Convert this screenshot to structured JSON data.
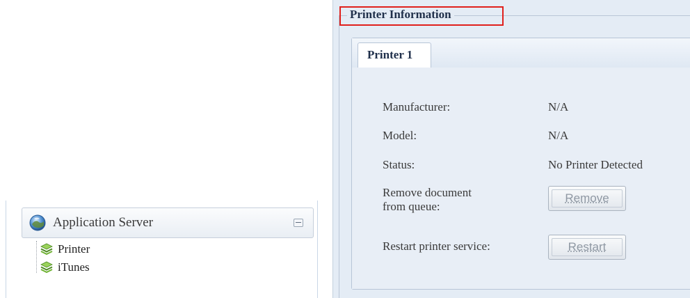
{
  "app_server": {
    "title": "Application Server",
    "icon": "globe-icon",
    "collapse_icon": "collapse-icon",
    "items": [
      {
        "label": "Printer",
        "icon": "layers-icon"
      },
      {
        "label": "iTunes",
        "icon": "layers-icon"
      }
    ]
  },
  "printer_info": {
    "legend": "Printer Information",
    "highlight_color": "#e0201c",
    "tabs": [
      {
        "label": "Printer 1"
      }
    ],
    "fields": {
      "manufacturer_label": "Manufacturer:",
      "manufacturer_value": "N/A",
      "model_label": "Model:",
      "model_value": "N/A",
      "status_label": "Status:",
      "status_value": "No Printer Detected",
      "remove_label_line1": "Remove document",
      "remove_label_line2": "from queue:",
      "restart_label": "Restart printer service:"
    },
    "buttons": {
      "remove": "Remove",
      "restart": "Restart"
    }
  },
  "colors": {
    "panel_bg": "#e4ecf5",
    "tab_body_bg": "#e8eef6",
    "heading": "#1f2f4a",
    "icon_green": "#7cc242"
  }
}
